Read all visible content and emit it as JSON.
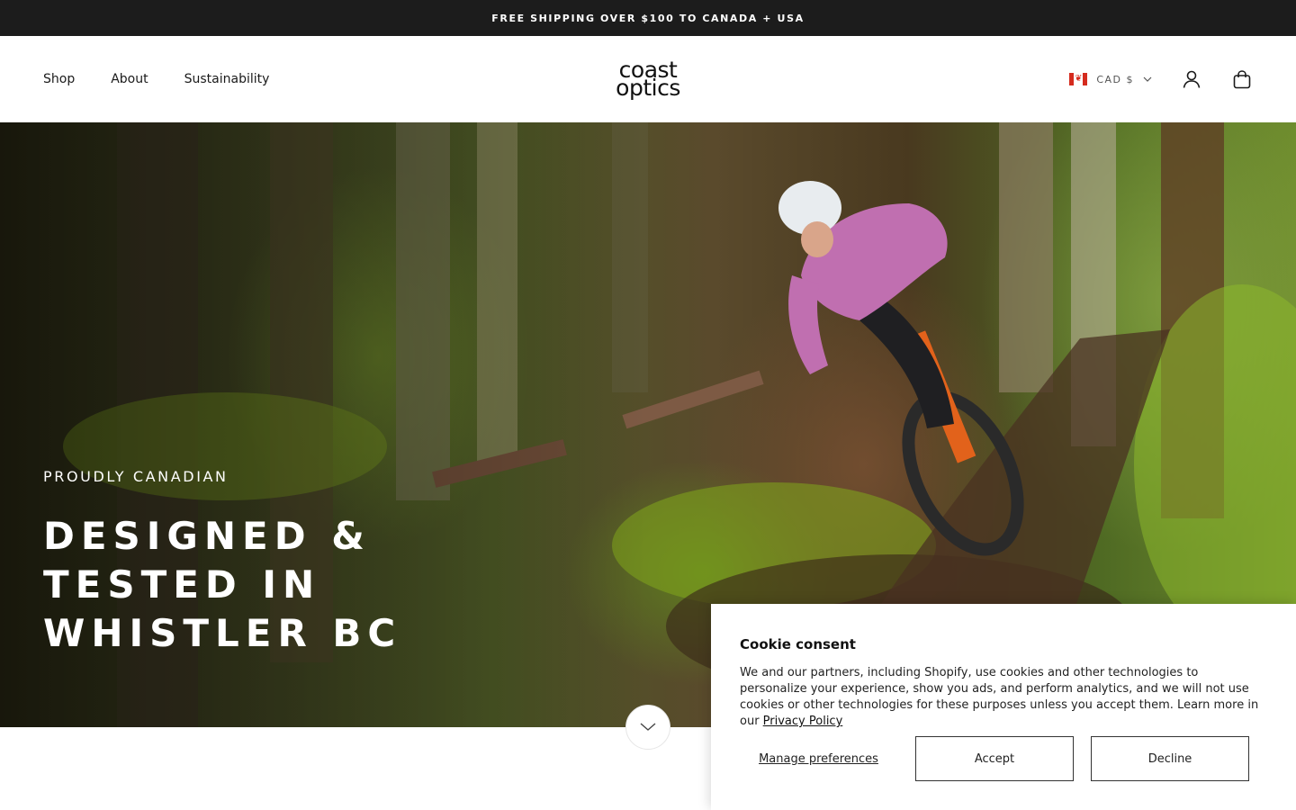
{
  "announcement": {
    "text": "FREE SHIPPING OVER $100 TO CANADA + USA"
  },
  "header": {
    "nav": [
      {
        "label": "Shop"
      },
      {
        "label": "About"
      },
      {
        "label": "Sustainability"
      }
    ],
    "logo": {
      "line1": "coast",
      "line2": "optics"
    },
    "currency": {
      "label": "CAD $",
      "flag": "canada-flag"
    },
    "icons": {
      "account": "account-icon",
      "cart": "bag-icon"
    }
  },
  "hero": {
    "eyebrow": "PROUDLY CANADIAN",
    "headline": "DESIGNED & TESTED IN WHISTLER BC",
    "scroll_icon": "chevron-down-icon"
  },
  "cookie": {
    "title": "Cookie consent",
    "body": "We and our partners, including Shopify, use cookies and other technologies to personalize your experience, show you ads, and perform analytics, and we will not use cookies or other technologies for these purposes unless you accept them. Learn more in our ",
    "link": "Privacy Policy",
    "manage": "Manage preferences",
    "accept": "Accept",
    "decline": "Decline"
  },
  "colors": {
    "announcement_bg": "#1c1c1c",
    "text": "#1a1a1a",
    "flag_red": "#d52b1e"
  }
}
